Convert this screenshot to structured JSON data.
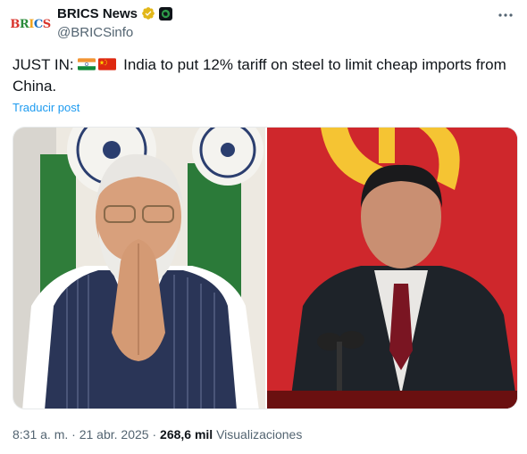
{
  "post": {
    "author": {
      "display_name": "BRICS News",
      "handle": "@BRICSinfo",
      "logo_text": "BRICS",
      "verified_badge": "gold-verified-icon",
      "affiliate_badge": "affiliate-badge-icon"
    },
    "more_icon": "more-options-icon",
    "text_prefix": "JUST IN:",
    "flags": [
      "india-flag-icon",
      "china-flag-icon"
    ],
    "text_body": "India to put 12% tariff on steel to limit cheap imports from China.",
    "translate_label": "Traducir post",
    "media": [
      {
        "kind": "photo",
        "label": "india-leader-photo"
      },
      {
        "kind": "photo",
        "label": "china-leader-photo"
      }
    ],
    "time": "8:31 a. m.",
    "separator": " · ",
    "date": "21 abr. 2025",
    "views_count": "268,6 mil",
    "views_label": "Visualizaciones"
  },
  "colors": {
    "text": "#0f1419",
    "secondary": "#536471",
    "link": "#1d9bf0",
    "verified_gold": "#e2b719"
  }
}
